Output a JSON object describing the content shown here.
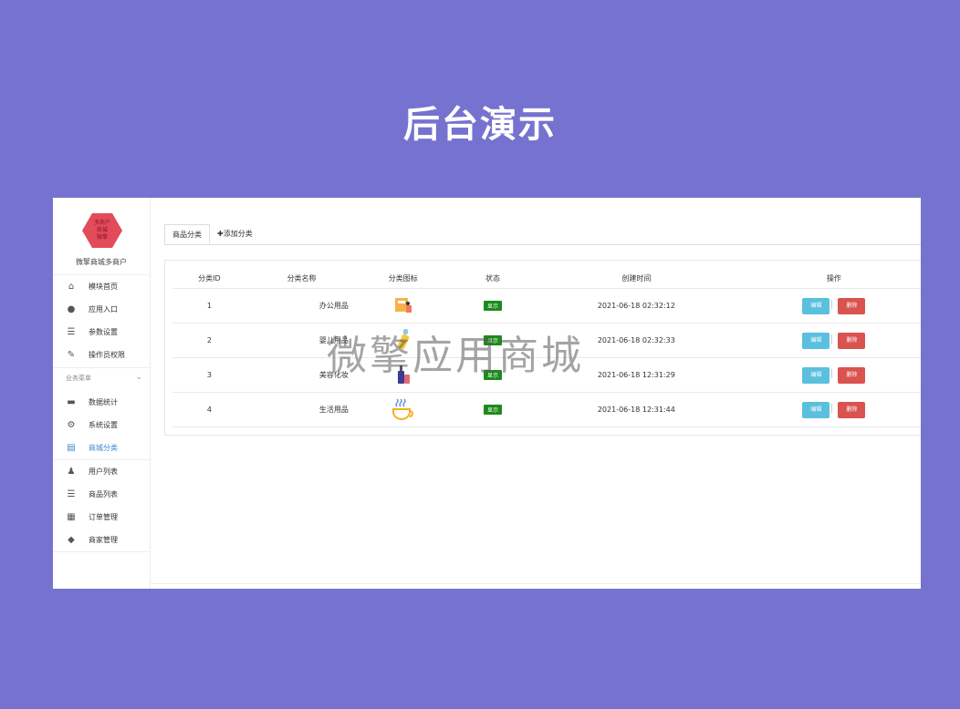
{
  "banner": {
    "title": "后台演示"
  },
  "watermark": "微擎应用商城",
  "sidebar": {
    "logo_lines": [
      "多商户",
      "商城",
      "微擎"
    ],
    "shop_name": "微擎商城多商户",
    "items": [
      {
        "label": "模块首页",
        "icon": "home-icon"
      },
      {
        "label": "应用入口",
        "icon": "chat-icon"
      },
      {
        "label": "参数设置",
        "icon": "list-icon"
      },
      {
        "label": "操作员权限",
        "icon": "doc-edit-icon"
      }
    ],
    "section_label": "业务菜单",
    "business_items": [
      {
        "label": "数据统计",
        "icon": "monitor-icon"
      },
      {
        "label": "系统设置",
        "icon": "gear-icon"
      },
      {
        "label": "商城分类",
        "icon": "doc-icon",
        "active": true
      },
      {
        "label": "用户列表",
        "icon": "users-icon"
      },
      {
        "label": "商品列表",
        "icon": "list-icon"
      },
      {
        "label": "订单管理",
        "icon": "grid-icon"
      },
      {
        "label": "商家管理",
        "icon": "box-icon"
      }
    ]
  },
  "tabs": {
    "active": "商品分类",
    "add": "添加分类"
  },
  "table": {
    "headers": [
      "分类ID",
      "分类名称",
      "分类图标",
      "状态",
      "创建时间",
      "操作"
    ],
    "rows": [
      {
        "id": "1",
        "name": "办公用品",
        "icon": "office-icon",
        "status": "显示",
        "created": "2021-06-18 02:32:12"
      },
      {
        "id": "2",
        "name": "婴儿用品",
        "icon": "baby-bottle-icon",
        "status": "显示",
        "created": "2021-06-18 02:32:33"
      },
      {
        "id": "3",
        "name": "美容化妆",
        "icon": "cosmetics-icon",
        "status": "显示",
        "created": "2021-06-18 12:31:29"
      },
      {
        "id": "4",
        "name": "生活用品",
        "icon": "coffee-cup-icon",
        "status": "显示",
        "created": "2021-06-18 12:31:44"
      }
    ],
    "edit_label": "编辑",
    "delete_label": "删除"
  },
  "colors": {
    "background": "#7672d0",
    "badge": "#1c8a1c",
    "edit": "#5bc0de",
    "delete": "#d9534f",
    "active_nav": "#3a86d6"
  }
}
